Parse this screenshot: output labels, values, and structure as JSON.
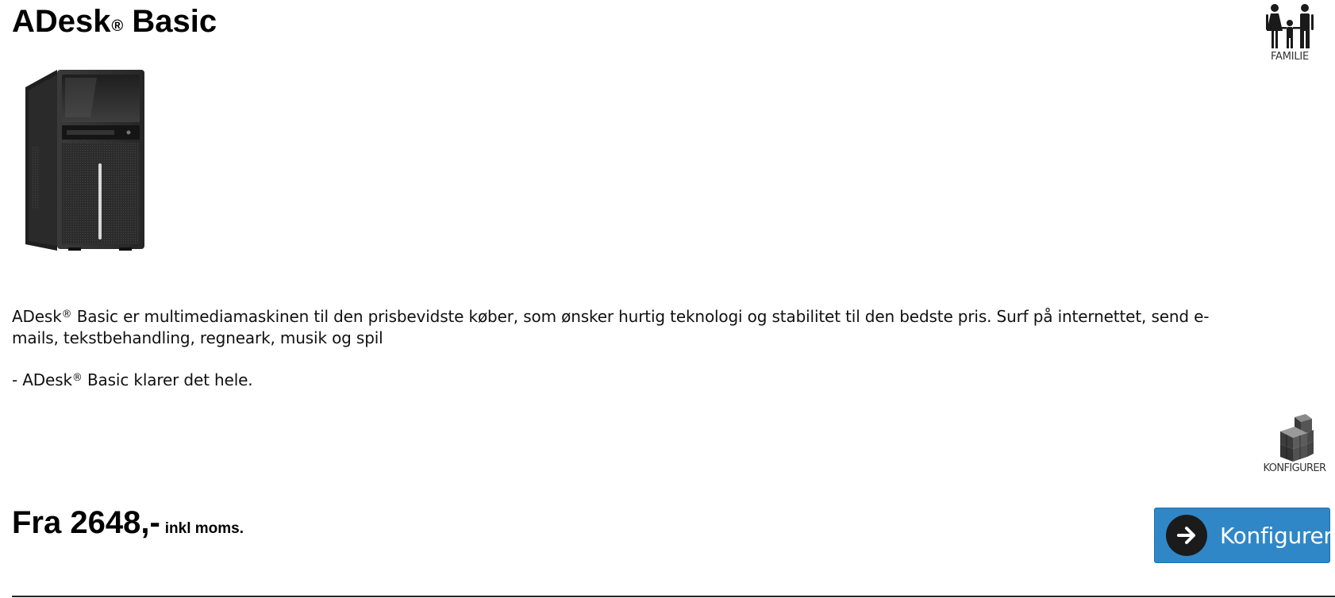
{
  "product": {
    "title": "ADesk",
    "title_reg": "®",
    "title_suffix": " Basic",
    "image_icon": "desktop-tower-icon"
  },
  "badges": {
    "family": {
      "icon": "family-icon",
      "label": "FAMILIE"
    },
    "configure": {
      "icon": "building-blocks-icon",
      "label": "KONFIGURER"
    }
  },
  "description": {
    "part1": "ADesk",
    "reg": "®",
    "part2": " Basic er multimediamaskinen til den prisbevidste køber, som ønsker hurtig teknologi og stabilitet til den bedste pris. Surf på internettet, send e-mails, tekstbehandling, regneark, musik og spil"
  },
  "tagline": {
    "part1": "- ADesk",
    "reg": "®",
    "part2": " Basic klarer det hele."
  },
  "price": {
    "main": "Fra 2648,-",
    "suffix": "inkl moms."
  },
  "configure_button": {
    "label": "Konfigurer",
    "icon": "arrow-right-circle-icon",
    "color": "#2f87c8"
  }
}
